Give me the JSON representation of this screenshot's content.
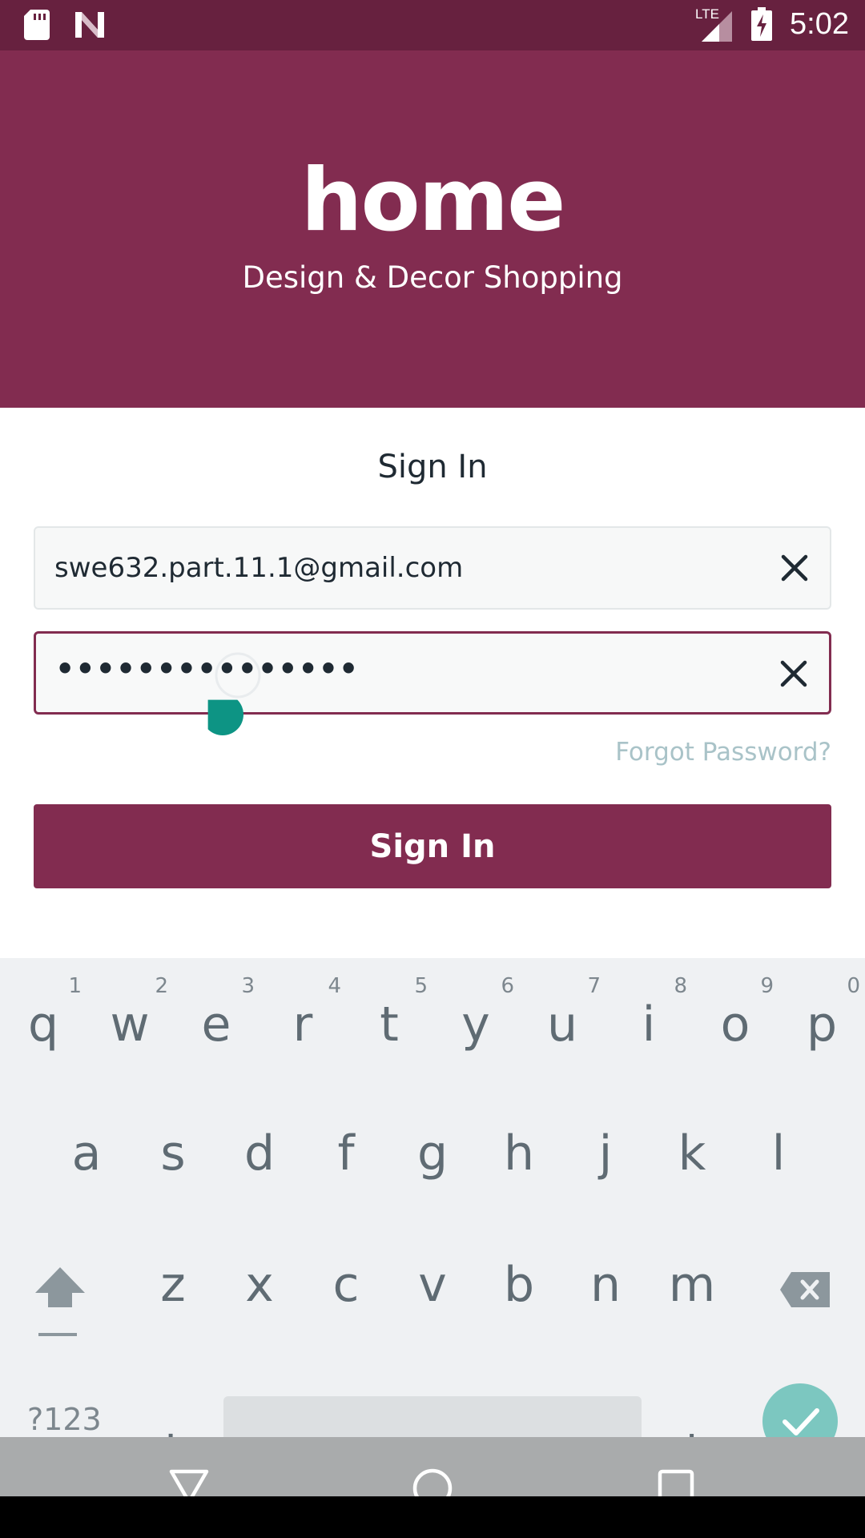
{
  "status_bar": {
    "time": "5:02",
    "network": "LTE",
    "icons": [
      "sd-card-icon",
      "notification-n-icon",
      "signal-icon",
      "battery-charging-icon"
    ]
  },
  "header": {
    "logo": "home",
    "tagline": "Design & Decor Shopping",
    "background_color": "#822c50"
  },
  "form": {
    "title": "Sign In",
    "email_value": "swe632.part.11.1@gmail.com",
    "password_value": "•••••••••••••••",
    "forgot_password": "Forgot Password?",
    "submit_label": "Sign In"
  },
  "keyboard": {
    "row1": [
      {
        "key": "q",
        "hint": "1"
      },
      {
        "key": "w",
        "hint": "2"
      },
      {
        "key": "e",
        "hint": "3"
      },
      {
        "key": "r",
        "hint": "4"
      },
      {
        "key": "t",
        "hint": "5"
      },
      {
        "key": "y",
        "hint": "6"
      },
      {
        "key": "u",
        "hint": "7"
      },
      {
        "key": "i",
        "hint": "8"
      },
      {
        "key": "o",
        "hint": "9"
      },
      {
        "key": "p",
        "hint": "0"
      }
    ],
    "row2": [
      "a",
      "s",
      "d",
      "f",
      "g",
      "h",
      "j",
      "k",
      "l"
    ],
    "row3": [
      "z",
      "x",
      "c",
      "v",
      "b",
      "n",
      "m"
    ],
    "symbols_label": "?123",
    "comma": ",",
    "period": ".",
    "accent_color": "#7cc7c0"
  },
  "nav_bar": {
    "buttons": [
      "back-icon",
      "home-icon",
      "recents-icon"
    ]
  }
}
